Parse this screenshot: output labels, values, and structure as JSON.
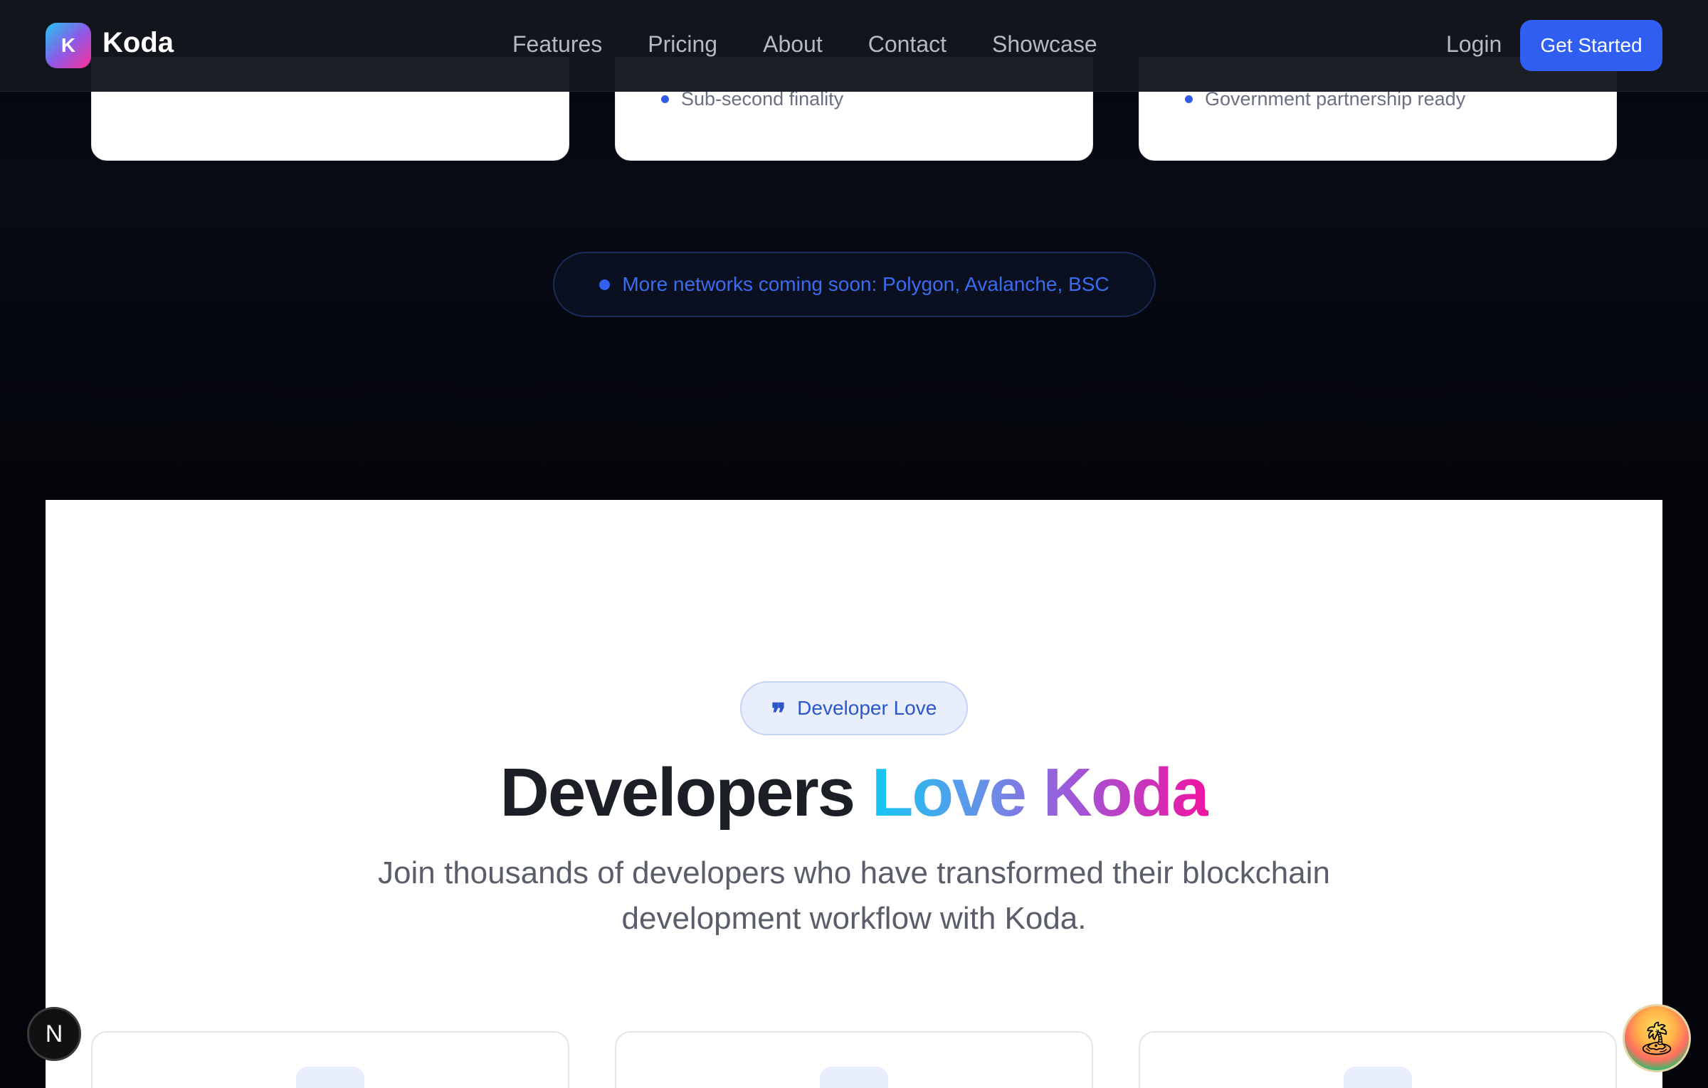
{
  "nav": {
    "logo_letter": "K",
    "brand": "Koda",
    "links": [
      "Features",
      "Pricing",
      "About",
      "Contact",
      "Showcase"
    ],
    "login": "Login",
    "cta": "Get Started"
  },
  "network_cards": {
    "middle_bullet": "Sub-second finality",
    "right_bullet": "Government partnership ready"
  },
  "networks_pill": "More networks coming soon: Polygon, Avalanche, BSC",
  "testimonials": {
    "badge": "Developer Love",
    "headline_plain": "Developers",
    "headline_gradient": "Love Koda",
    "subtitle": "Join thousands of developers who have transformed their blockchain development workflow with Koda."
  },
  "floating": {
    "n_button": "N"
  }
}
